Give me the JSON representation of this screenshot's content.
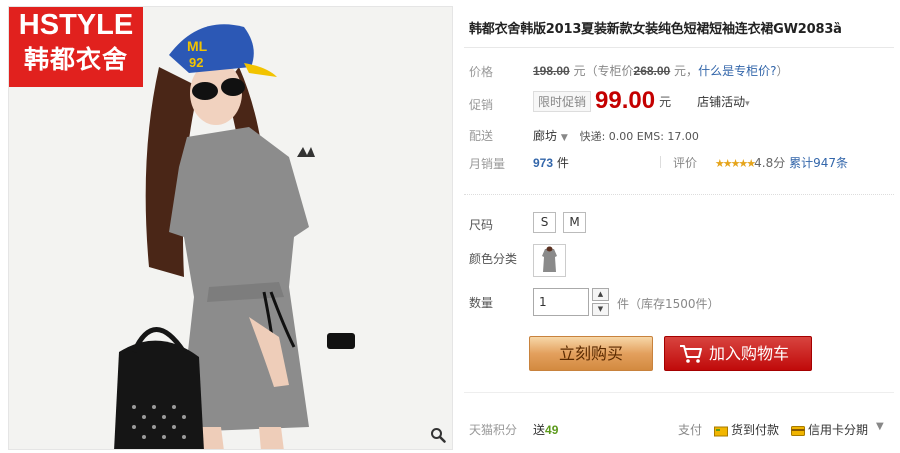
{
  "brand": {
    "logo_line1": "HSTYLE",
    "logo_line2": "韩都衣舍"
  },
  "product": {
    "title": "韩都衣舍韩版2013夏装新款女装纯色短裙短袖连衣裙GW2083ȁ"
  },
  "price": {
    "label": "价格",
    "original": "198.00",
    "unit_open": " 元（专柜价",
    "counter": "268.00",
    "unit_close": " 元，",
    "counter_link": "什么是专柜价?",
    "paren_close": "）"
  },
  "promo": {
    "label": "促销",
    "tag": "限时促销",
    "price": "99.00",
    "unit": "元",
    "shop_activity": "店铺活动"
  },
  "shipping": {
    "label": "配送",
    "from": "廊坊",
    "express": "快递: 0.00 EMS: 17.00"
  },
  "sales": {
    "label": "月销量",
    "count": "973",
    "unit": "件",
    "rating_label": "评价",
    "stars": "★★★★★",
    "score": "4.8分",
    "total": "累计947条"
  },
  "options": {
    "size_label": "尺码",
    "sizes": [
      "S",
      "M"
    ],
    "color_label": "颜色分类"
  },
  "quantity": {
    "label": "数量",
    "value": "1",
    "stock": "件（库存1500件）"
  },
  "buttons": {
    "buy_now": "立刻购买",
    "add_cart": "加入购物车"
  },
  "footer": {
    "points_label": "天猫积分",
    "points_prefix": "送",
    "points_value": "49",
    "pay_label": "支付",
    "cod": "货到付款",
    "installment": "信用卡分期"
  },
  "colors": {
    "accent_red": "#c40000",
    "logo_red": "#e1211e",
    "buy_orange": "#e3a05e",
    "cart_red": "#c00a0a",
    "link_blue": "#3366aa"
  },
  "icons": [
    "zoom-icon",
    "cart-icon",
    "cod-icon",
    "card-icon",
    "chevron-down-icon",
    "arrow-up-icon",
    "arrow-down-icon",
    "star-icon"
  ]
}
